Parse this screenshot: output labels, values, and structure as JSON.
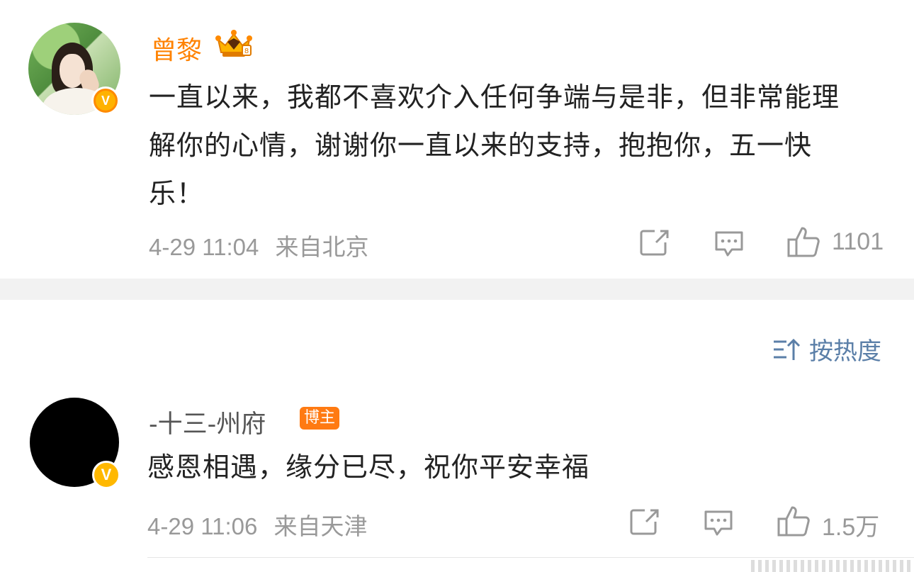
{
  "post": {
    "author": "曾黎",
    "badge_icon": "crown-icon",
    "verified_icon": "verified-v-icon",
    "text": "一直以来，我都不喜欢介入任何争端与是非，但非常能理解你的心情，谢谢你一直以来的支持，抱抱你，五一快乐！",
    "time": "4-29 11:04",
    "location": "来自北京",
    "likes": "1101"
  },
  "sort": {
    "label": "按热度",
    "icon": "sort-icon"
  },
  "comment": {
    "author": "-十三-州府",
    "tag": "博主",
    "verified_icon": "verified-v-icon",
    "text": "感恩相遇，缘分已尽，祝你平安幸福",
    "time": "4-29 11:06",
    "location": "来自天津",
    "likes": "1.5万"
  },
  "colors": {
    "name_orange": "#ff8200",
    "meta_gray": "#999999",
    "sort_blue": "#5b7fa8",
    "tag_orange": "#ff7a12",
    "divider": "#f2f2f2"
  }
}
